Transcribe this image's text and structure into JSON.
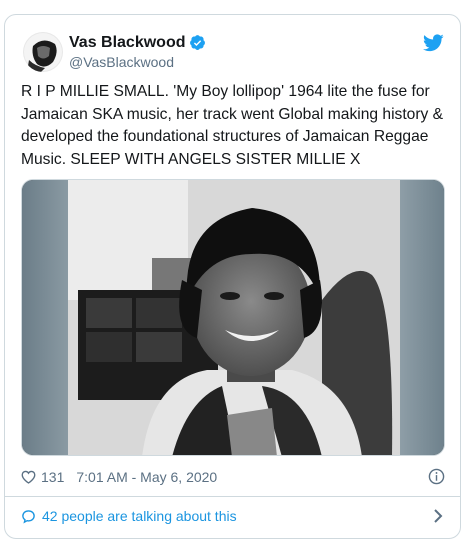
{
  "tweet": {
    "author": {
      "display_name": "Vas Blackwood",
      "handle": "@VasBlackwood",
      "verified": true
    },
    "text": "R I P MILLIE SMALL. 'My Boy lollipop' 1964 lite the fuse for Jamaican SKA music, her track went Global making history & developed the foundational structures of Jamaican Reggae Music. SLEEP WITH ANGELS SISTER MILLIE X",
    "media": {
      "kind": "black-and-white photo",
      "subject": "smiling woman with bob hairstyle wearing a geometric-print top"
    },
    "likes": "131",
    "timestamp": "7:01 AM - May 6, 2020",
    "conversation_link": "42 people are talking about this"
  },
  "icons": {
    "verified": "verified-badge-icon",
    "brand": "twitter-bird-icon",
    "like": "heart-icon",
    "info": "info-icon",
    "conversation": "speech-bubble-icon",
    "chevron": "chevron-right-icon"
  },
  "colors": {
    "accent": "#1da1f2",
    "link": "#1b95e0",
    "secondary_text": "#5b7083",
    "border": "#cfd9de"
  }
}
